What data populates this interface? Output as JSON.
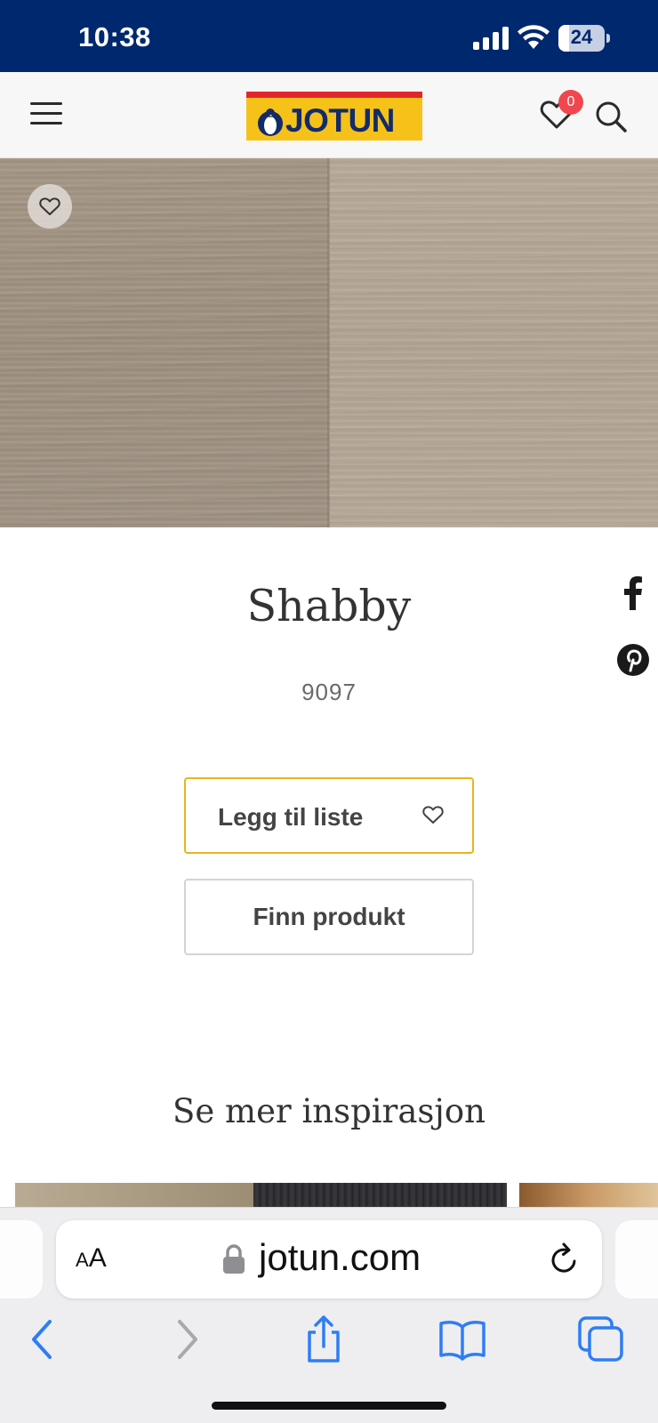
{
  "status_bar": {
    "time": "10:38",
    "battery": "24",
    "battery_level": 0.24
  },
  "header": {
    "logo_text": "JOTUN",
    "wishlist_count": "0",
    "icons": {
      "menu": "hamburger-menu-icon",
      "wishlist": "heart-icon",
      "search": "search-icon"
    }
  },
  "hero": {
    "favorite_icon": "heart-icon"
  },
  "product": {
    "name": "Shabby",
    "code": "9097",
    "add_to_list_label": "Legg til liste",
    "find_product_label": "Finn produkt"
  },
  "share": {
    "icons": [
      "facebook-icon",
      "pinterest-icon"
    ]
  },
  "inspiration": {
    "title": "Se mer inspirasjon"
  },
  "browser": {
    "aa_label_small": "A",
    "aa_label_large": "A",
    "url": "jotun.com",
    "icons": [
      "back-icon",
      "forward-icon",
      "share-icon",
      "bookmarks-icon",
      "tabs-icon"
    ]
  },
  "colors": {
    "brand_navy": "#00286e",
    "accent_yellow": "#e8b61c",
    "badge_red": "#f0474f",
    "ios_blue": "#2f7df6"
  }
}
